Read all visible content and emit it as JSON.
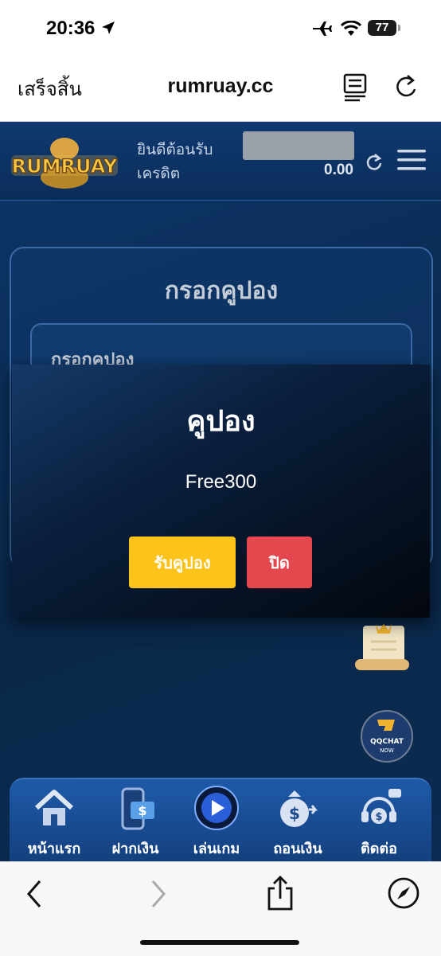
{
  "status_bar": {
    "time": "20:36",
    "battery": "77"
  },
  "browser": {
    "done_label": "เสร็จสิ้น",
    "url": "rumruay.cc"
  },
  "site_header": {
    "logo_text": "RUMRUAY",
    "welcome": "ยินดีต้อนรับ",
    "credit_label": "เครดิต",
    "credit_value": "0.00"
  },
  "coupon_page": {
    "title": "กรอกคูปอง",
    "input_label": "กรอกคูปอง"
  },
  "chat_badge": {
    "line1": "QQCHAT",
    "line2": "NOW"
  },
  "modal": {
    "title": "คูปอง",
    "code": "Free300",
    "claim_label": "รับคูปอง",
    "close_label": "ปิด"
  },
  "bottom_nav": {
    "items": [
      {
        "label": "หน้าแรก",
        "icon": "home-icon"
      },
      {
        "label": "ฝากเงิน",
        "icon": "deposit-icon"
      },
      {
        "label": "เล่นเกม",
        "icon": "play-icon"
      },
      {
        "label": "ถอนเงิน",
        "icon": "withdraw-icon"
      },
      {
        "label": "ติดต่อ",
        "icon": "contact-icon"
      }
    ]
  },
  "colors": {
    "claim_button": "#fcc31a",
    "close_button": "#e4474e",
    "header_bg": "#0f3970"
  }
}
